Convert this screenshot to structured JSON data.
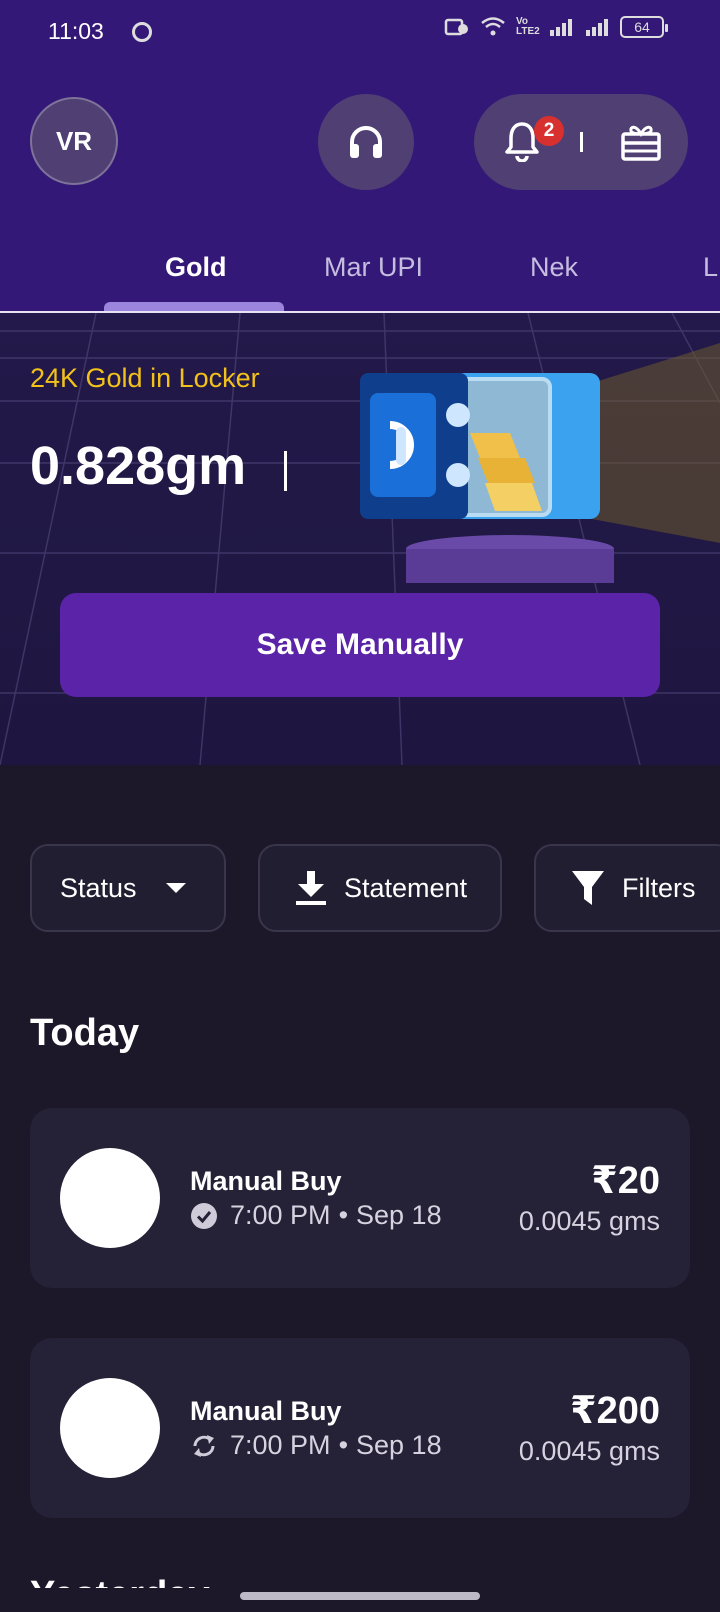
{
  "status_bar": {
    "time": "11:03",
    "network_label": "Vo LTE2",
    "battery": "64"
  },
  "header": {
    "avatar_initials": "VR",
    "notification_count": "2"
  },
  "tabs": [
    {
      "label": "Gold",
      "active": true
    },
    {
      "label": "Mar UPI",
      "active": false
    },
    {
      "label": "Nek",
      "active": false
    },
    {
      "label": "L",
      "active": false
    }
  ],
  "hero": {
    "label": "24K Gold in Locker",
    "value": "0.828gm",
    "save_button": "Save Manually"
  },
  "filters": {
    "status": "Status",
    "statement": "Statement",
    "filters": "Filters"
  },
  "sections": {
    "today": "Today",
    "next": "Yesterday"
  },
  "transactions": [
    {
      "title": "Manual Buy",
      "time": "7:00 PM",
      "date": "Sep 18",
      "amount": "₹20",
      "grams": "0.0045 gms",
      "status": "completed"
    },
    {
      "title": "Manual Buy",
      "time": "7:00 PM",
      "date": "Sep 18",
      "amount": "₹200",
      "grams": "0.0045 gms",
      "status": "recurring"
    }
  ],
  "colors": {
    "header_bg": "#341878",
    "accent_gold": "#f2c21a",
    "button_purple": "#5a23a8",
    "badge_red": "#d8302f"
  }
}
